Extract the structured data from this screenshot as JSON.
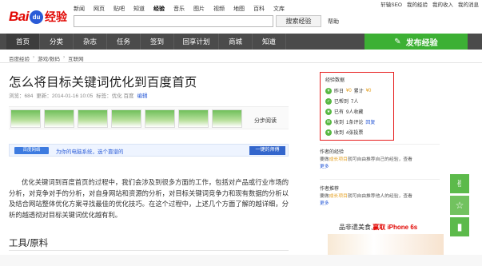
{
  "logo": {
    "bai": "Bai",
    "du": "du",
    "jingyan": "经验"
  },
  "topnav": [
    "新闻",
    "网页",
    "贴吧",
    "知道",
    "经验",
    "音乐",
    "图片",
    "视频",
    "地图",
    "百科",
    "文库"
  ],
  "topnav_current": "经验",
  "search": {
    "button": "搜索经验",
    "help": "帮助"
  },
  "user": {
    "name": "轩辕SEO",
    "links": [
      "我的经验",
      "我的收入",
      "我的消息"
    ]
  },
  "mainnav": [
    "首页",
    "分类",
    "杂志",
    "任务",
    "签到",
    "回享计划",
    "商城",
    "知道"
  ],
  "publish": "发布经验",
  "breadcrumb": [
    "百度经验",
    "游戏/数码",
    "互联网"
  ],
  "article": {
    "title": "怎么将目标关键词优化到百度首页",
    "meta": [
      "浏览：684",
      "更新：2014-01-16 10:05",
      "标签：优化 百度"
    ],
    "edit": "编辑",
    "fenbu": "分步阅读",
    "banner_tag": "百度网络",
    "banner_text": "为你的电脑系统，选个靠谱的",
    "banner_btn": "一键的师傅",
    "body": "优化关键词到百度首页的过程中，我们会涉及到很多方面的工作，包括对产品或行业市场的分析，对竞争对手的分析，对自身网站和资源的分析，对目标关键词竞争力和现有数据的分析以及结合网站整体优化方案寻找最佳的优化技巧。在这个过程中，上述几个方面了解的越详细，分析的越透彻对目标关键词优化越有利。",
    "tools": "工具/原料"
  },
  "stats": {
    "title": "经验数据",
    "rows": [
      {
        "icon": "coin-icon",
        "parts": [
          "昨日",
          "¥0",
          "累计",
          "¥0"
        ]
      },
      {
        "icon": "thumb-icon",
        "parts": [
          "已帮到",
          "7人"
        ]
      },
      {
        "icon": "check-icon",
        "parts": [
          "已有",
          "9人收藏"
        ]
      },
      {
        "icon": "comment-icon",
        "parts": [
          "收到",
          "1条评论",
          "回复"
        ]
      },
      {
        "icon": "vote-icon",
        "parts": [
          "收到",
          "4张投票"
        ]
      }
    ]
  },
  "side": {
    "recommend_title": "作者的经验",
    "recommend_text": "要做",
    "recommend_link": "成长项目",
    "recommend_rest": "就可自由推荐自己的经验，查看",
    "recommend_more": "更多",
    "recommend2_title": "作者推荐",
    "recommend2_text": "要做",
    "recommend2_link": "成长项目",
    "recommend2_rest": "就可自由推荐他人的经验，查看",
    "recommend2_more": "更多"
  },
  "ad": {
    "text_a": "品非遗美食,",
    "text_b": "赢取 iPhone 6s"
  },
  "colors": {
    "accent": "#3cb034",
    "nav": "#4b4b4b",
    "brand": "#e10602",
    "link": "#2a5bd7",
    "highlight": "#e61c1c"
  }
}
